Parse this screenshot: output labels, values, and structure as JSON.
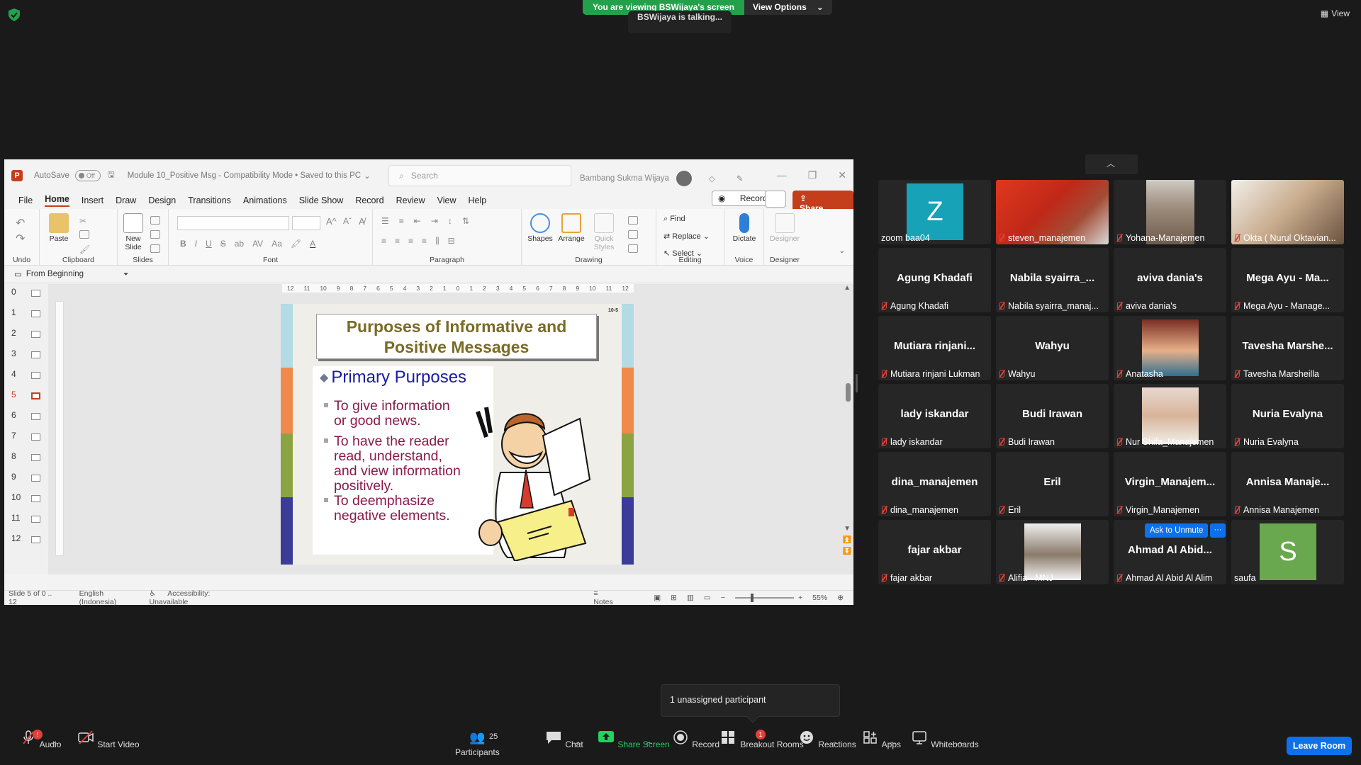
{
  "banner": {
    "viewing": "You are viewing BSWijaya's screen",
    "view_options": "View Options",
    "talking": "BSWijaya is talking...",
    "view": "View"
  },
  "ppt": {
    "autosave": "AutoSave",
    "autosave_state": "Off",
    "file_title": "Module 10_Positive Msg  -  Compatibility Mode  •  Saved to this PC",
    "search_placeholder": "Search",
    "user": "Bambang Sukma Wijaya",
    "menus": [
      "File",
      "Home",
      "Insert",
      "Draw",
      "Design",
      "Transitions",
      "Animations",
      "Slide Show",
      "Record",
      "Review",
      "View",
      "Help"
    ],
    "record_btn": "Record",
    "share_btn": "Share",
    "groups": {
      "undo": "Undo",
      "clipboard": "Clipboard",
      "slides": "Slides",
      "font": "Font",
      "paragraph": "Paragraph",
      "drawing": "Drawing",
      "editing": "Editing",
      "voice": "Voice",
      "designer": "Designer"
    },
    "buttons": {
      "paste": "Paste",
      "new_slide": "New\nSlide",
      "shapes": "Shapes",
      "arrange": "Arrange",
      "quick_styles": "Quick\nStyles",
      "find": "Find",
      "replace": "Replace",
      "select": "Select",
      "dictate": "Dictate",
      "designer": "Designer"
    },
    "from_beginning": "From Beginning",
    "thumbnails": [
      "0",
      "1",
      "2",
      "3",
      "4",
      "5",
      "6",
      "7",
      "8",
      "9",
      "10",
      "11",
      "12"
    ],
    "active_thumbnail": "5",
    "ruler": [
      "12",
      "11",
      "10",
      "9",
      "8",
      "7",
      "6",
      "5",
      "4",
      "3",
      "2",
      "1",
      "0",
      "1",
      "2",
      "3",
      "4",
      "5",
      "6",
      "7",
      "8",
      "9",
      "10",
      "11",
      "12"
    ],
    "status": {
      "slide": "Slide 5 of 0 .. 12",
      "language": "English (Indonesia)",
      "accessibility": "Accessibility: Unavailable",
      "notes": "Notes",
      "zoom": "55%"
    }
  },
  "slide": {
    "number": "10-5",
    "title_line1": "Purposes of Informative and",
    "title_line2": "Positive Messages",
    "heading": "Primary Purposes",
    "bullets": [
      [
        "To give information",
        "or good news."
      ],
      [
        "To have the reader",
        "read, understand,",
        "and view information",
        "positively."
      ],
      [
        "To deemphasize",
        "negative elements."
      ]
    ]
  },
  "participants": [
    {
      "display": "",
      "label": "zoom baa04",
      "avatar": "Z",
      "avatar_color": "#17a2b8",
      "muted": false
    },
    {
      "display": "",
      "label": "steven_manajemen",
      "photo": true,
      "muted": true
    },
    {
      "display": "",
      "label": "Yohana-Manajemen",
      "photo": true,
      "muted": true
    },
    {
      "display": "",
      "label": "Okta ( Nurul Oktavian...",
      "photo": true,
      "muted": true
    },
    {
      "display": "Agung Khadafi",
      "label": "Agung Khadafi",
      "muted": true
    },
    {
      "display": "Nabila  syairra_...",
      "label": "Nabila syairra_manaj...",
      "muted": true
    },
    {
      "display": "aviva dania's",
      "label": "aviva dania's",
      "muted": true
    },
    {
      "display": "Mega Ayu - Ma...",
      "label": "Mega Ayu - Manage...",
      "muted": true
    },
    {
      "display": "Mutiara  rinjani...",
      "label": "Mutiara rinjani Lukman",
      "muted": true
    },
    {
      "display": "Wahyu",
      "label": "Wahyu",
      "muted": true
    },
    {
      "display": "",
      "label": "Anatasha",
      "photo": true,
      "muted": true
    },
    {
      "display": "Tavesha  Marshe...",
      "label": "Tavesha Marsheilla",
      "muted": true
    },
    {
      "display": "lady iskandar",
      "label": "lady iskandar",
      "muted": true
    },
    {
      "display": "Budi Irawan",
      "label": "Budi Irawan",
      "muted": true
    },
    {
      "display": "",
      "label": "Nur Shifa_Manajemen",
      "photo": true,
      "muted": true
    },
    {
      "display": "Nuria Evalyna",
      "label": "Nuria Evalyna",
      "muted": true
    },
    {
      "display": "dina_manajemen",
      "label": "dina_manajemen",
      "muted": true
    },
    {
      "display": "Eril",
      "label": "Eril",
      "muted": true
    },
    {
      "display": "Virgin_Manajem...",
      "label": "Virgin_Manajemen",
      "muted": true
    },
    {
      "display": "Annisa  Manaje...",
      "label": "Annisa Manajemen",
      "muted": true
    },
    {
      "display": "fajar akbar",
      "label": "fajar akbar",
      "muted": true
    },
    {
      "display": "",
      "label": "Alifia - MNJ",
      "photo": true,
      "muted": true
    },
    {
      "display": "Ahmad Al Abid...",
      "label": "Ahmad Al Abid Al Alim",
      "muted": true
    },
    {
      "display": "",
      "label": "saufa",
      "avatar": "S",
      "avatar_color": "#6aa84f",
      "muted": false
    }
  ],
  "ask_to_unmute": "Ask to Unmute",
  "unassigned": "1 unassigned participant",
  "toolbar": {
    "audio": "Audio",
    "start_video": "Start Video",
    "participants": "Participants",
    "participants_count": "25",
    "chat": "Chat",
    "share_screen": "Share Screen",
    "record": "Record",
    "breakout_rooms": "Breakout Rooms",
    "breakout_badge": "1",
    "reactions": "Reactions",
    "apps": "Apps",
    "whiteboards": "Whiteboards",
    "audio_badge": "!",
    "leave": "Leave Room"
  },
  "colors": {
    "zoom_green": "#23a14a",
    "zoom_blue": "#0e71eb",
    "ppt_accent": "#c43e1c",
    "muted_red": "#e0403a"
  }
}
